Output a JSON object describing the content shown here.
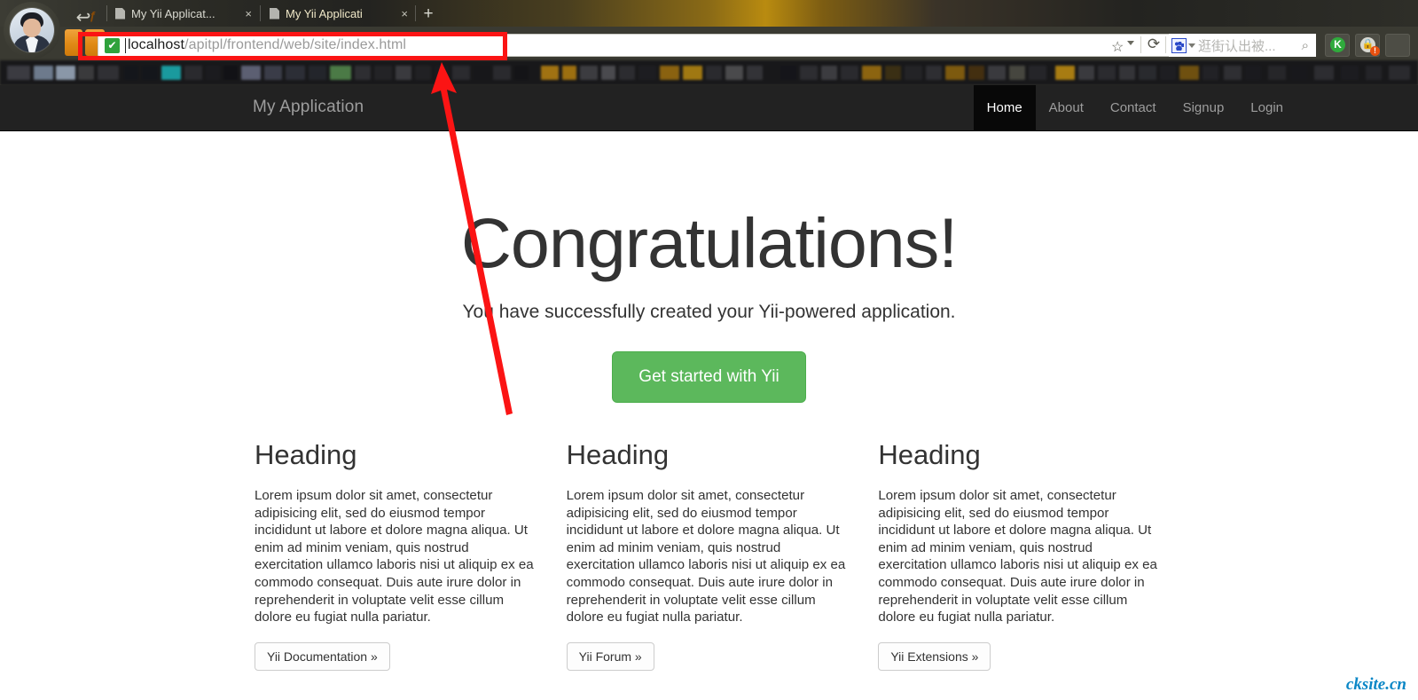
{
  "browser": {
    "avatar_alt": "user-avatar",
    "back_label": "↩",
    "new_tab_label": "+",
    "tabs": [
      {
        "title": "My Yii Applicat...",
        "close": "×",
        "active": false
      },
      {
        "title": "My Yii Applicati",
        "close": "×",
        "active": true
      }
    ],
    "omnibox": {
      "ssl_glyph": "✔",
      "url_host": "localhost",
      "url_path": "/apitpl/frontend/web/site/index.html",
      "url_full": "localhost/apitpl/frontend/web/site/index.html"
    },
    "chip_glyph": "ƒ",
    "star_glyph": "☆",
    "reload_glyph": "⟳",
    "search": {
      "engine": "baidu-icon",
      "value": "逛街认出被...",
      "magnifier": "⌕"
    },
    "extensions": [
      {
        "name": "kingsoft-k-icon",
        "label": "K"
      },
      {
        "name": "lock-icon",
        "label": "🔒",
        "badge": "!"
      }
    ]
  },
  "site": {
    "brand": "My Application",
    "nav": [
      {
        "label": "Home",
        "active": true
      },
      {
        "label": "About",
        "active": false
      },
      {
        "label": "Contact",
        "active": false
      },
      {
        "label": "Signup",
        "active": false
      },
      {
        "label": "Login",
        "active": false
      }
    ],
    "jumbotron": {
      "title": "Congratulations!",
      "subtitle": "You have successfully created your Yii-powered application.",
      "cta_label": "Get started with Yii",
      "cta_color": "#5cb85c"
    },
    "columns": [
      {
        "heading": "Heading",
        "body": "Lorem ipsum dolor sit amet, consectetur adipisicing elit, sed do eiusmod tempor incididunt ut labore et dolore magna aliqua. Ut enim ad minim veniam, quis nostrud exercitation ullamco laboris nisi ut aliquip ex ea commodo consequat. Duis aute irure dolor in reprehenderit in voluptate velit esse cillum dolore eu fugiat nulla pariatur.",
        "button": "Yii Documentation »"
      },
      {
        "heading": "Heading",
        "body": "Lorem ipsum dolor sit amet, consectetur adipisicing elit, sed do eiusmod tempor incididunt ut labore et dolore magna aliqua. Ut enim ad minim veniam, quis nostrud exercitation ullamco laboris nisi ut aliquip ex ea commodo consequat. Duis aute irure dolor in reprehenderit in voluptate velit esse cillum dolore eu fugiat nulla pariatur.",
        "button": "Yii Forum »"
      },
      {
        "heading": "Heading",
        "body": "Lorem ipsum dolor sit amet, consectetur adipisicing elit, sed do eiusmod tempor incididunt ut labore et dolore magna aliqua. Ut enim ad minim veniam, quis nostrud exercitation ullamco laboris nisi ut aliquip ex ea commodo consequat. Duis aute irure dolor in reprehenderit in voluptate velit esse cillum dolore eu fugiat nulla pariatur.",
        "button": "Yii Extensions »"
      }
    ],
    "watermark": "cksite.cn",
    "navbar_color": "#222222",
    "watermark_color": "#0b87c6"
  },
  "annotation": {
    "highlight_color": "#fb1414",
    "target": "address-bar"
  }
}
